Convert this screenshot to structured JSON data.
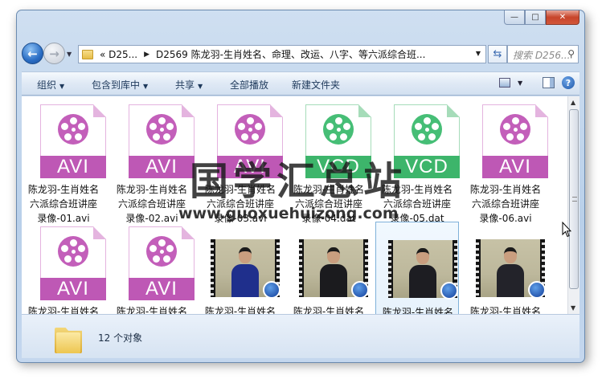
{
  "window": {
    "minimize_glyph": "—",
    "maximize_glyph": "□",
    "close_glyph": "✕"
  },
  "nav": {
    "address_crumb_1": "«  D25...",
    "address_crumb_2": "D2569 陈龙羽-生肖姓名、命理、改运、八字、等六派综合班...",
    "search_placeholder": "搜索 D256..."
  },
  "toolbar": {
    "organize": "组织",
    "include_in_library": "包含到库中",
    "share": "共享",
    "play_all": "全部播放",
    "new_folder": "新建文件夹"
  },
  "icons": {
    "back": "back-arrow-icon",
    "forward": "forward-arrow-icon",
    "refresh": "refresh-icon",
    "search": "search-icon",
    "views": "views-icon",
    "preview_pane": "preview-pane-icon",
    "help": "help-icon",
    "folder": "folder-icon",
    "video_file": "video-file-icon"
  },
  "colors": {
    "avi_band": "#be58b5",
    "avi_reel": "#c35fba",
    "avi_fold": "#e4b4df",
    "vcd_band": "#3db56b",
    "vcd_reel": "#46be76",
    "vcd_fold": "#a6dcb9"
  },
  "files": [
    {
      "type": "AVI",
      "line1": "陈龙羽-生肖姓名",
      "line2": "六派综合班讲座",
      "line3": "录像-01.avi"
    },
    {
      "type": "AVI",
      "line1": "陈龙羽-生肖姓名",
      "line2": "六派综合班讲座",
      "line3": "录像-02.avi"
    },
    {
      "type": "AVI",
      "line1": "陈龙羽-生肖姓名",
      "line2": "六派综合班讲座",
      "line3": "录像-03.avi"
    },
    {
      "type": "VCD",
      "line1": "陈龙羽-生肖姓名",
      "line2": "六派综合班讲座",
      "line3": "录像-04.dat"
    },
    {
      "type": "VCD",
      "line1": "陈龙羽-生肖姓名",
      "line2": "六派综合班讲座",
      "line3": "录像-05.dat"
    },
    {
      "type": "AVI",
      "line1": "陈龙羽-生肖姓名",
      "line2": "六派综合班讲座",
      "line3": "录像-06.avi"
    },
    {
      "type": "AVI",
      "line1": "陈龙羽-生肖姓名"
    },
    {
      "type": "AVI",
      "line1": "陈龙羽-生肖姓名"
    },
    {
      "type": "video",
      "line1": "陈龙羽-生肖姓名",
      "shirt": "#1f2f8c"
    },
    {
      "type": "video",
      "line1": "陈龙羽-生肖姓名",
      "shirt": "#1b1b1e"
    },
    {
      "type": "video",
      "line1": "陈龙羽-生肖姓名",
      "shirt": "#1d1d22",
      "selected": true
    },
    {
      "type": "video",
      "line1": "陈龙羽-生肖姓名",
      "shirt": "#23232a"
    }
  ],
  "status": {
    "count_text": "12 个对象"
  },
  "watermark": {
    "title": "国学汇总站",
    "url": "www.guoxuehuizong.com"
  }
}
